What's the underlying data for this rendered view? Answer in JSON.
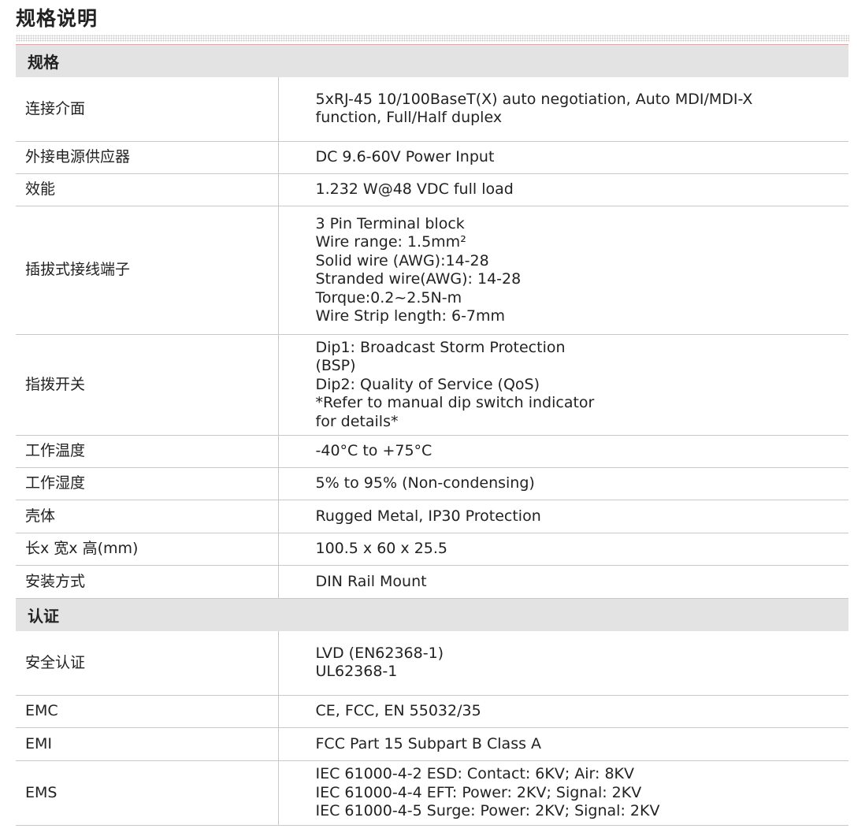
{
  "page_title": "规格说明",
  "sections": [
    {
      "title": "规格",
      "rows": [
        {
          "label": "连接介面",
          "lines": [
            "5xRJ-45 10/100BaseT(X) auto negotiation, Auto MDI/MDI-X",
            "function, Full/Half duplex"
          ]
        },
        {
          "label": "外接电源供应器",
          "lines": [
            "DC 9.6-60V Power Input"
          ]
        },
        {
          "label": "效能",
          "lines": [
            "1.232 W@48 VDC full load"
          ]
        },
        {
          "label": "插拔式接线端子",
          "lines": [
            "3 Pin Terminal block",
            "Wire range: 1.5mm²",
            "Solid wire (AWG):14-28",
            "Stranded wire(AWG): 14-28",
            "Torque:0.2~2.5N-m",
            "Wire Strip length: 6-7mm"
          ]
        },
        {
          "label": "指拨开关",
          "lines": [
            "Dip1: Broadcast Storm Protection",
            "(BSP)",
            "Dip2: Quality of Service (QoS)",
            "*Refer to manual dip switch indicator",
            "for details*"
          ]
        },
        {
          "label": "工作温度",
          "lines": [
            "-40°C to +75°C"
          ]
        },
        {
          "label": "工作湿度",
          "lines": [
            "5% to 95% (Non-condensing)"
          ]
        },
        {
          "label": "壳体",
          "lines": [
            "Rugged Metal, IP30 Protection"
          ]
        },
        {
          "label": "长x 宽x 高(mm)",
          "lines": [
            "100.5 x 60 x 25.5"
          ]
        },
        {
          "label": "安装方式",
          "lines": [
            "DIN Rail Mount"
          ]
        }
      ]
    },
    {
      "title": "认证",
      "rows": [
        {
          "label": "安全认证",
          "lines": [
            "LVD (EN62368-1)",
            "UL62368-1"
          ]
        },
        {
          "label": "EMC",
          "lines": [
            "CE, FCC, EN 55032/35"
          ]
        },
        {
          "label": "EMI",
          "lines": [
            "FCC Part 15 Subpart B Class A"
          ]
        },
        {
          "label": "EMS",
          "lines": [
            "IEC 61000-4-2 ESD: Contact: 6KV; Air: 8KV",
            "IEC 61000-4-4 EFT: Power: 2KV; Signal: 2KV",
            "IEC 61000-4-5 Surge: Power: 2KV; Signal: 2KV"
          ]
        }
      ]
    }
  ]
}
